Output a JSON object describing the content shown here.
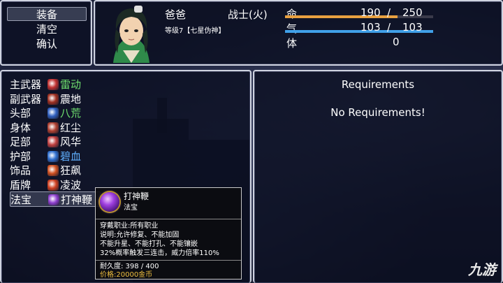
{
  "command_menu": {
    "items": [
      {
        "label": "装备"
      },
      {
        "label": "清空"
      },
      {
        "label": "确认"
      }
    ]
  },
  "actor": {
    "name": "爸爸",
    "class": "战士(火)",
    "level_title": "等级7【七星伪神】",
    "stats": {
      "hp": {
        "label": "命",
        "current": "190",
        "sep": "/",
        "max": "250",
        "ratio": 0.76,
        "color": "#e8a040"
      },
      "mp": {
        "label": "气",
        "current": "103",
        "sep": "/",
        "max": "103",
        "ratio": 1.0,
        "color": "#40a0e8"
      },
      "stamina": {
        "label": "体",
        "value": "0"
      }
    }
  },
  "equipment_slots": [
    {
      "slot": "主武器",
      "item": "雷动",
      "item_color": "#6fe06f",
      "icon_color": "#c03030"
    },
    {
      "slot": "副武器",
      "item": "震地",
      "item_color": "#ffffff",
      "icon_color": "#a03020"
    },
    {
      "slot": "头部",
      "item": "八荒",
      "item_color": "#6fe06f",
      "icon_color": "#3060c0"
    },
    {
      "slot": "身体",
      "item": "红尘",
      "item_color": "#ffffff",
      "icon_color": "#b04030"
    },
    {
      "slot": "足部",
      "item": "风华",
      "item_color": "#ffffff",
      "icon_color": "#c04040"
    },
    {
      "slot": "护部",
      "item": "碧血",
      "item_color": "#60b0ff",
      "icon_color": "#3070d0"
    },
    {
      "slot": "饰品",
      "item": "狂飙",
      "item_color": "#ffffff",
      "icon_color": "#d05020"
    },
    {
      "slot": "盾牌",
      "item": "凌波",
      "item_color": "#ffffff",
      "icon_color": "#d04020"
    },
    {
      "slot": "法宝",
      "item": "打神鞭",
      "item_color": "#ffffff",
      "icon_color": "#9040d0"
    }
  ],
  "requirements": {
    "title": "Requirements",
    "message": "No Requirements!"
  },
  "tooltip": {
    "name": "打神鞭",
    "type": "法宝",
    "lines": [
      "穿戴职业:所有职业",
      "说明:允许修复、不能加固",
      "不能升星、不能打孔、不能镶嵌",
      "32%概率触发三连击，威力倍率110%"
    ],
    "durability": "耐久度: 398 / 400",
    "price": "价格:20000金币"
  },
  "watermark": "九游"
}
